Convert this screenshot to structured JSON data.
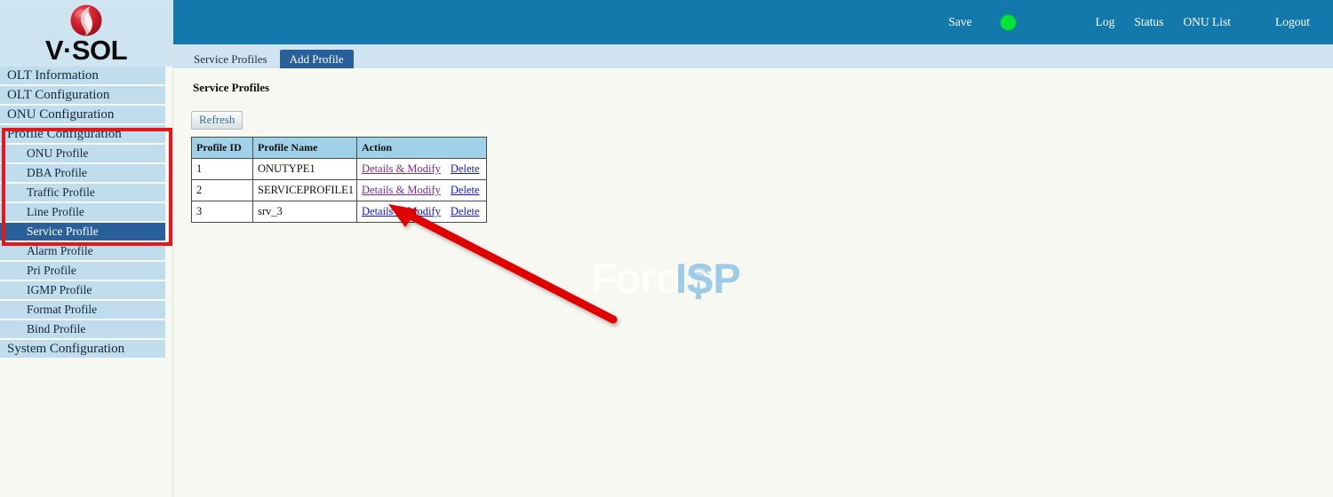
{
  "brand": {
    "wordmark": "V·SOL",
    "logo_icon": "vsol-sphere-logo-icon",
    "logo_color": "#cf1f2e"
  },
  "topbar": {
    "background_color": "#1378ab",
    "save_label": "Save",
    "status_indicator": {
      "icon": "status-dot-icon",
      "color": "#00e632",
      "state": "online"
    },
    "links": [
      {
        "label": "Log",
        "name": "log"
      },
      {
        "label": "Status",
        "name": "status"
      },
      {
        "label": "ONU List",
        "name": "onu-list"
      }
    ],
    "logout_label": "Logout"
  },
  "sidebar": {
    "item_background": "#bfdded",
    "selected_background": "#2a6099",
    "highlight_box_color": "#e8161b",
    "items": [
      {
        "label": "OLT Information",
        "level": 1,
        "selected": false
      },
      {
        "label": "OLT Configuration",
        "level": 1,
        "selected": false
      },
      {
        "label": "ONU Configuration",
        "level": 1,
        "selected": false
      },
      {
        "label": "Profile Configuration",
        "level": 1,
        "selected": false
      },
      {
        "label": "ONU Profile",
        "level": 2,
        "selected": false
      },
      {
        "label": "DBA Profile",
        "level": 2,
        "selected": false
      },
      {
        "label": "Traffic Profile",
        "level": 2,
        "selected": false
      },
      {
        "label": "Line Profile",
        "level": 2,
        "selected": false
      },
      {
        "label": "Service Profile",
        "level": 2,
        "selected": true
      },
      {
        "label": "Alarm Profile",
        "level": 2,
        "selected": false
      },
      {
        "label": "Pri Profile",
        "level": 2,
        "selected": false
      },
      {
        "label": "IGMP Profile",
        "level": 2,
        "selected": false
      },
      {
        "label": "Format Profile",
        "level": 2,
        "selected": false
      },
      {
        "label": "Bind Profile",
        "level": 2,
        "selected": false
      },
      {
        "label": "System Configuration",
        "level": 1,
        "selected": false
      }
    ]
  },
  "tabs": [
    {
      "label": "Service Profiles",
      "active": false
    },
    {
      "label": "Add Profile",
      "active": true
    }
  ],
  "main": {
    "heading": "Service Profiles",
    "refresh_label": "Refresh",
    "table": {
      "headers": [
        "Profile ID",
        "Profile Name",
        "Action"
      ],
      "rows": [
        {
          "id": "1",
          "name": "ONUTYPE1",
          "modify_label": "Details & Modify",
          "delete_label": "Delete",
          "modify_visited": true
        },
        {
          "id": "2",
          "name": "SERVICEPROFILE1",
          "modify_label": "Details & Modify",
          "delete_label": "Delete",
          "modify_visited": true
        },
        {
          "id": "3",
          "name": "srv_3",
          "modify_label": "Details & Modify",
          "delete_label": "Delete",
          "modify_visited": false
        }
      ]
    }
  },
  "watermark": {
    "text_left": "Foro",
    "text_right": "ISP",
    "icon": "wifi-tower-icon",
    "color_left": "#fdfdfb",
    "color_right": "#9dcbe8"
  },
  "annotation": {
    "arrow_color": "#e00000",
    "arrow_target": "details-modify-link-row-3"
  }
}
